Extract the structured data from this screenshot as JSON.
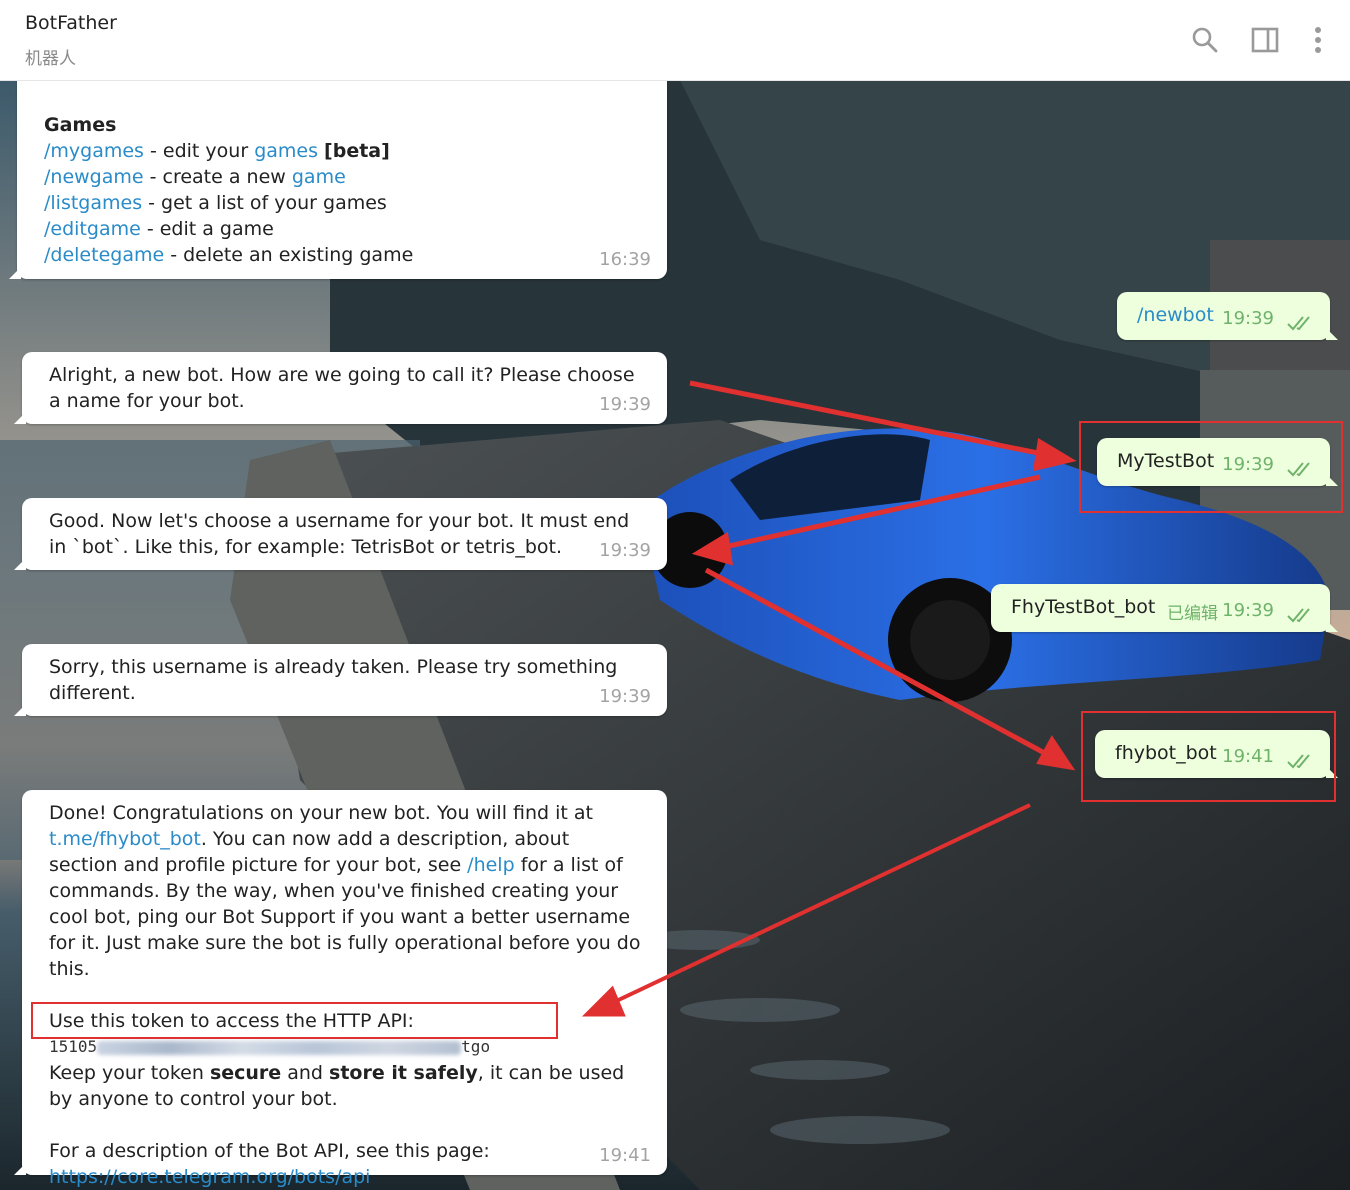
{
  "header": {
    "title": "BotFather",
    "subtitle": "机器人",
    "icons": [
      "search-icon",
      "sidebar-toggle-icon",
      "more-vertical-icon"
    ]
  },
  "colors": {
    "command": "#2a8bc9",
    "outgoing_bg": "#eeffde",
    "outgoing_time": "#6fb36a",
    "annotation": "#e03030"
  },
  "messages": {
    "games": {
      "heading": "Games",
      "lines": [
        {
          "cmd": "/mygames",
          "t1": " - edit your ",
          "link": "games",
          "t2": " ",
          "bold": "[beta]"
        },
        {
          "cmd": "/newgame",
          "t1": " - create a new ",
          "link": "game"
        },
        {
          "cmd": "/listgames",
          "t1": " - get a list of your games"
        },
        {
          "cmd": "/editgame",
          "t1": " - edit a game"
        },
        {
          "cmd": "/deletegame",
          "t1": " - delete an existing game"
        }
      ],
      "time": "16:39"
    },
    "newbot": {
      "text": "/newbot",
      "time": "19:39"
    },
    "alright": {
      "text": "Alright, a new bot. How are we going to call it? Please choose a name for your bot.",
      "time": "19:39"
    },
    "mytestbot": {
      "text": "MyTestBot",
      "time": "19:39"
    },
    "good": {
      "text": "Good. Now let's choose a username for your bot. It must end in `bot`. Like this, for example: TetrisBot or tetris_bot.",
      "time": "19:39"
    },
    "fhytestbot": {
      "text": "FhyTestBot_bot",
      "edited": "已编辑",
      "time": "19:39"
    },
    "sorry": {
      "text": "Sorry, this username is already taken. Please try something different.",
      "time": "19:39"
    },
    "fhybot": {
      "text": "fhybot_bot",
      "time": "19:41"
    },
    "done": {
      "p1a": "Done! Congratulations on your new bot. You will find it at ",
      "p1link": "t.me/fhybot_bot",
      "p1b": ". You can now add a description, about section and profile picture for your bot, see ",
      "p1help": "/help",
      "p1c": " for a list of commands. By the way, when you've finished creating your cool bot, ping our Bot Support if you want a better username for it. Just make sure the bot is fully operational before you do this.",
      "token_intro": "Use this token to access the HTTP API:",
      "token_start": "15105",
      "token_end": "tgo",
      "keep_a": "Keep your token ",
      "keep_b1": "secure",
      "keep_c": " and ",
      "keep_b2": "store it safely",
      "keep_d": ", it can be used by anyone to control your bot.",
      "api_intro": "For a description of the Bot API, see this page:",
      "api_link": "https://core.telegram.org/bots/api",
      "time": "19:41"
    }
  }
}
